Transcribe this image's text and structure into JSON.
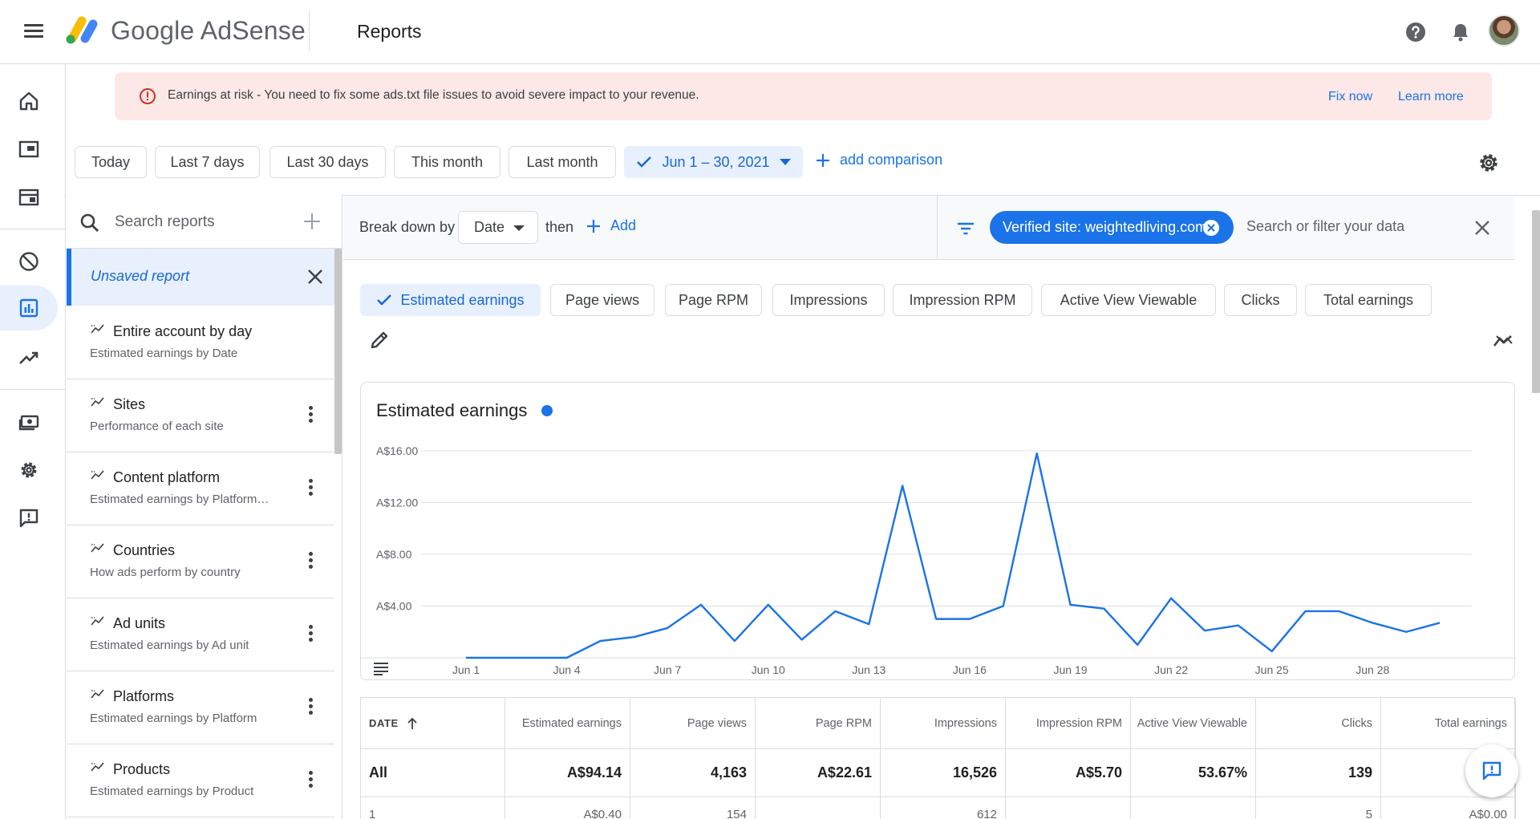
{
  "header": {
    "brand_google": "Google",
    "brand_product": "AdSense",
    "page_title": "Reports"
  },
  "rail": {
    "items": [
      "home-icon",
      "ads-icon",
      "sites-icon",
      "blocking-icon",
      "reports-icon",
      "optimization-icon",
      "payments-icon",
      "settings-icon",
      "feedback-icon"
    ],
    "active": "reports-icon"
  },
  "alert": {
    "text": "Earnings at risk - You need to fix some ads.txt file issues to avoid severe impact to your revenue.",
    "fix_label": "Fix now",
    "learn_label": "Learn more"
  },
  "date_ranges": [
    "Today",
    "Last 7 days",
    "Last 30 days",
    "This month",
    "Last month"
  ],
  "selected_range": "Jun 1 – 30, 2021",
  "add_comparison_label": "add comparison",
  "reports_panel": {
    "search_placeholder": "Search reports",
    "unsaved_label": "Unsaved report",
    "items": [
      {
        "title": "Entire account by day",
        "subtitle": "Estimated earnings by Date"
      },
      {
        "title": "Sites",
        "subtitle": "Performance of each site"
      },
      {
        "title": "Content platform",
        "subtitle": "Estimated earnings by Platform…"
      },
      {
        "title": "Countries",
        "subtitle": "How ads perform by country"
      },
      {
        "title": "Ad units",
        "subtitle": "Estimated earnings by Ad unit"
      },
      {
        "title": "Platforms",
        "subtitle": "Estimated earnings by Platform"
      },
      {
        "title": "Products",
        "subtitle": "Estimated earnings by Product"
      }
    ]
  },
  "breakdown": {
    "label": "Break down by",
    "value": "Date",
    "then_label": "then",
    "add_label": "Add"
  },
  "filter": {
    "chip_label": "Verified site: weightedliving.com",
    "search_placeholder": "Search or filter your data"
  },
  "metrics": {
    "items": [
      "Estimated earnings",
      "Page views",
      "Page RPM",
      "Impressions",
      "Impression RPM",
      "Active View Viewable",
      "Clicks",
      "Total earnings"
    ],
    "selected": "Estimated earnings"
  },
  "chart_title": "Estimated earnings",
  "chart_data": {
    "type": "line",
    "title": "Estimated earnings",
    "y_ticks": [
      "A$4.00",
      "A$8.00",
      "A$12.00",
      "A$16.00"
    ],
    "ylim": [
      0,
      16
    ],
    "x_ticks": [
      "Jun 1",
      "Jun 4",
      "Jun 7",
      "Jun 10",
      "Jun 13",
      "Jun 16",
      "Jun 19",
      "Jun 22",
      "Jun 25",
      "Jun 28"
    ],
    "x": [
      "Jun 1",
      "Jun 2",
      "Jun 3",
      "Jun 4",
      "Jun 5",
      "Jun 6",
      "Jun 7",
      "Jun 8",
      "Jun 9",
      "Jun 10",
      "Jun 11",
      "Jun 12",
      "Jun 13",
      "Jun 14",
      "Jun 15",
      "Jun 16",
      "Jun 17",
      "Jun 18",
      "Jun 19",
      "Jun 20",
      "Jun 21",
      "Jun 22",
      "Jun 23",
      "Jun 24",
      "Jun 25",
      "Jun 26",
      "Jun 27",
      "Jun 28",
      "Jun 29",
      "Jun 30"
    ],
    "series": [
      {
        "values": [
          0,
          0,
          0,
          0,
          1.3,
          1.6,
          2.3,
          4.1,
          1.3,
          4.1,
          1.4,
          3.6,
          2.6,
          13.3,
          3.0,
          3.0,
          4.0,
          15.8,
          4.1,
          3.8,
          1.0,
          4.6,
          2.1,
          2.5,
          0.5,
          3.6,
          3.6,
          2.7,
          2.0,
          2.7
        ]
      }
    ],
    "grid": true,
    "color": "#1a73e8"
  },
  "table": {
    "headers": [
      "DATE",
      "Estimated earnings",
      "Page views",
      "Page RPM",
      "Impressions",
      "Impression RPM",
      "Active View Viewable",
      "Clicks",
      "Total earnings"
    ],
    "total_row": [
      "All",
      "A$94.14",
      "4,163",
      "A$22.61",
      "16,526",
      "A$5.70",
      "53.67%",
      "139",
      "A"
    ],
    "partial_row": [
      "1",
      "A$0.40",
      "154",
      "",
      "612",
      "",
      "",
      "5",
      "A$0.00"
    ]
  }
}
